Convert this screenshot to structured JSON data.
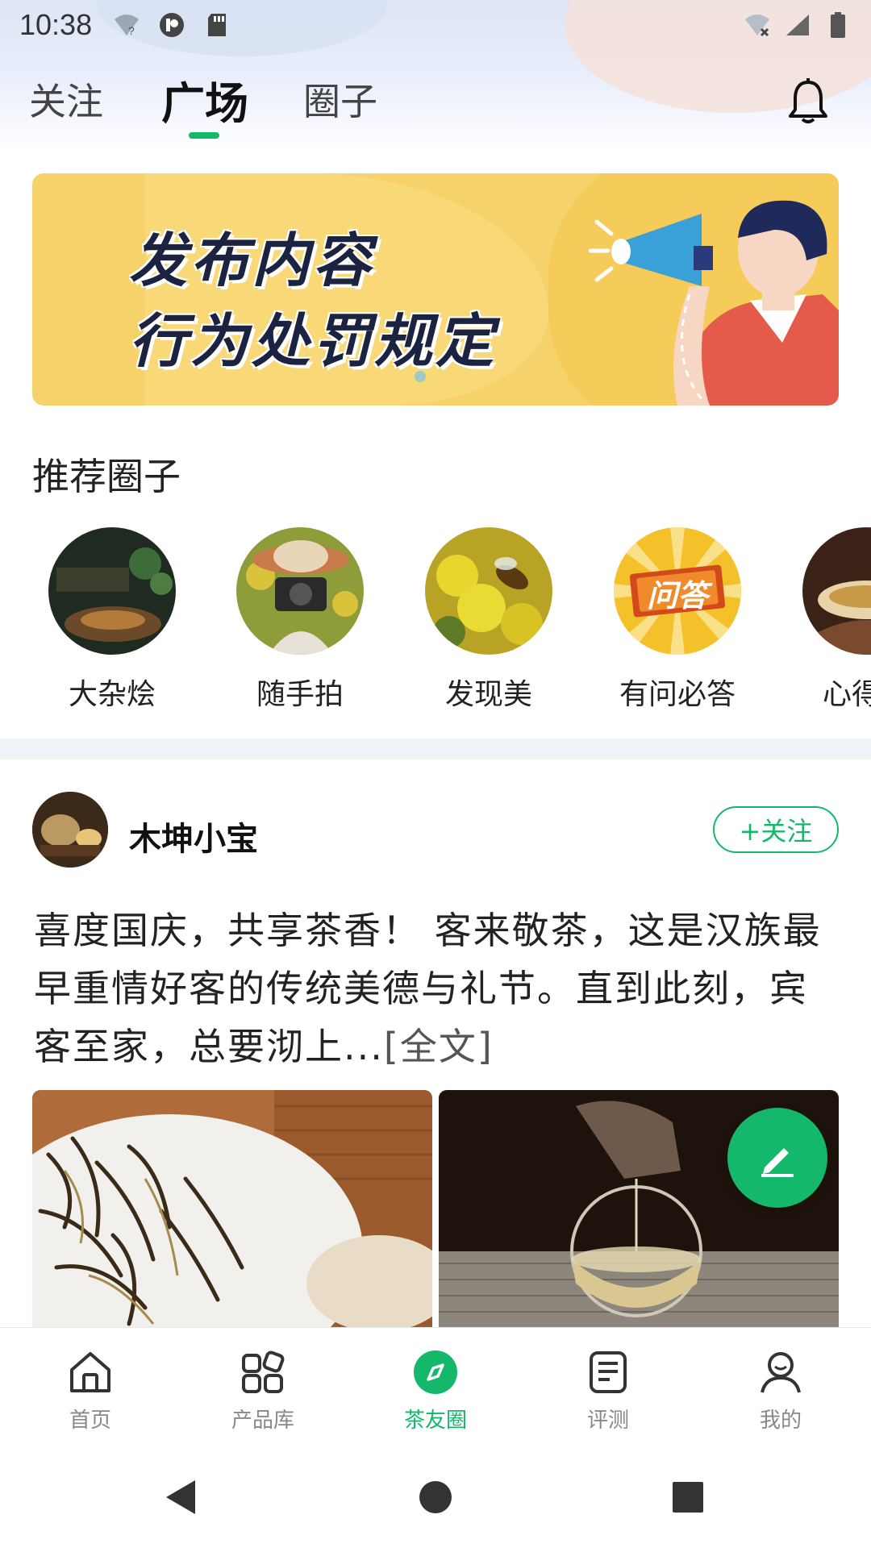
{
  "status_bar": {
    "time": "10:38"
  },
  "top_tabs": [
    {
      "label": "关注",
      "active": false
    },
    {
      "label": "广场",
      "active": true
    },
    {
      "label": "圈子",
      "active": false
    }
  ],
  "banner": {
    "line1": "发布内容",
    "line2": "行为处罚规定"
  },
  "recommend": {
    "title": "推荐圈子",
    "items": [
      {
        "label": "大杂烩"
      },
      {
        "label": "随手拍"
      },
      {
        "label": "发现美"
      },
      {
        "label": "有问必答",
        "image_text": "问答"
      },
      {
        "label": "心得分"
      }
    ]
  },
  "post": {
    "username": "木坤小宝",
    "follow_label": "+关注",
    "text": "喜度国庆，共享茶香！     客来敬茶，这是汉族最早重情好客的传统美德与礼节。直到此刻，宾客至家，总要沏上...",
    "more_label": "[全文]"
  },
  "bottom_nav": [
    {
      "label": "首页",
      "icon": "home-icon",
      "active": false
    },
    {
      "label": "产品库",
      "icon": "grid-icon",
      "active": false
    },
    {
      "label": "茶友圈",
      "icon": "compass-icon",
      "active": true
    },
    {
      "label": "评测",
      "icon": "review-icon",
      "active": false
    },
    {
      "label": "我的",
      "icon": "user-icon",
      "active": false
    }
  ],
  "colors": {
    "accent": "#14b86b",
    "banner_bg": "#f6d26b",
    "divider": "#eef3f9"
  }
}
